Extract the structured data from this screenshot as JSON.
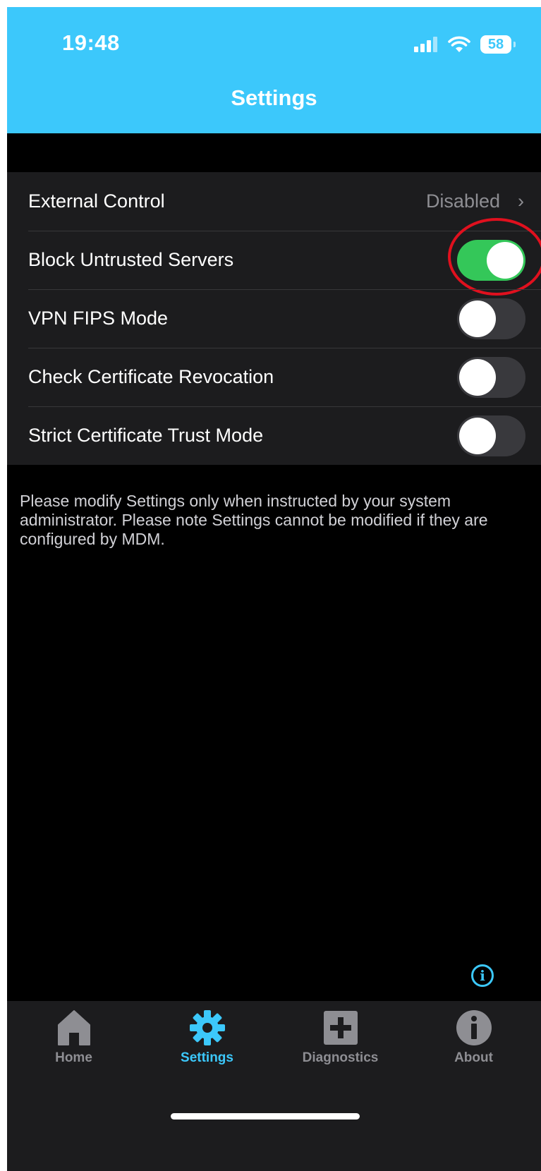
{
  "status_bar": {
    "time": "19:48",
    "battery": "58"
  },
  "header": {
    "title": "Settings"
  },
  "settings": {
    "rows": [
      {
        "label": "External Control",
        "value": "Disabled"
      },
      {
        "label": "Block Untrusted Servers",
        "toggle": true
      },
      {
        "label": "VPN FIPS Mode",
        "toggle": false
      },
      {
        "label": "Check Certificate Revocation",
        "toggle": false
      },
      {
        "label": "Strict Certificate Trust Mode",
        "toggle": false
      }
    ],
    "footnote": "Please modify Settings only when instructed by your system administrator. Please note Settings cannot be modified if they are configured by MDM."
  },
  "info_glyph": "i",
  "tabbar": {
    "tabs": [
      {
        "label": "Home",
        "icon": "home-icon",
        "active": false
      },
      {
        "label": "Settings",
        "icon": "gear-icon",
        "active": true
      },
      {
        "label": "Diagnostics",
        "icon": "plus-square-icon",
        "active": false
      },
      {
        "label": "About",
        "icon": "info-circle-icon",
        "active": false
      }
    ]
  },
  "colors": {
    "accent": "#3cc8fb",
    "toggle_on": "#34c759",
    "annotation_ring": "#e0101e"
  }
}
